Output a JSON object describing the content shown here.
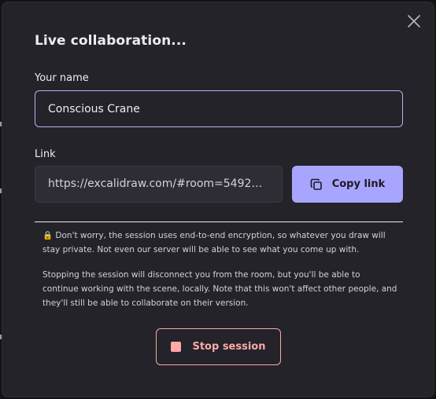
{
  "dialog": {
    "title": "Live collaboration...",
    "close_icon": "close-icon"
  },
  "name_field": {
    "label": "Your name",
    "value": "Conscious Crane"
  },
  "link_field": {
    "label": "Link",
    "value": "https://excalidraw.com/#room=5492462…"
  },
  "copy_button": {
    "label": "Copy link",
    "icon": "copy-icon"
  },
  "info": {
    "encryption_text": "🔒 Don't worry, the session uses end-to-end encryption, so whatever you draw will stay private. Not even our server will be able to see what you come up with.",
    "stop_text": "Stopping the session will disconnect you from the room, but you'll be able to continue working with the scene, locally. Note that this won't affect other people, and they'll still be able to collaborate on their version."
  },
  "stop_button": {
    "label": "Stop session",
    "icon": "stop-icon"
  },
  "colors": {
    "background": "#232329",
    "accent": "#a8a5ff",
    "danger": "#ffa8a8",
    "text": "#ececf4"
  }
}
